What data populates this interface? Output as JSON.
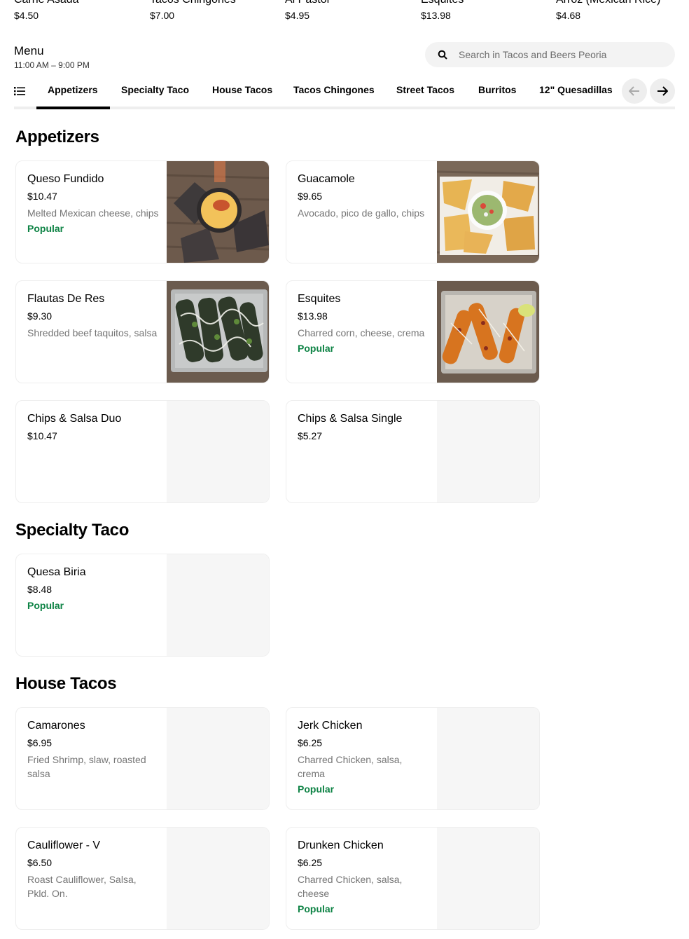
{
  "top_items": [
    {
      "name": "Carne Asada",
      "price": "$4.50"
    },
    {
      "name": "Tacos Chingones",
      "price": "$7.00"
    },
    {
      "name": "Al Pastor",
      "price": "$4.95"
    },
    {
      "name": "Esquites",
      "price": "$13.98"
    },
    {
      "name": "Arroz (Mexican Rice)",
      "price": "$4.68"
    }
  ],
  "menu": {
    "title": "Menu",
    "hours": "11:00 AM – 9:00 PM"
  },
  "search": {
    "placeholder": "Search in Tacos and Beers Peoria"
  },
  "tabs": [
    "Appetizers",
    "Specialty Taco",
    "House Tacos",
    "Tacos Chingones",
    "Street Tacos",
    "Burritos",
    "12\" Quesadillas"
  ],
  "active_tab": "Appetizers",
  "sections": [
    {
      "title": "Appetizers",
      "items": [
        {
          "name": "Queso Fundido",
          "price": "$10.47",
          "desc": "Melted Mexican cheese, chips",
          "popular": "Popular",
          "image": "queso-fundido-photo"
        },
        {
          "name": "Guacamole",
          "price": "$9.65",
          "desc": "Avocado, pico de gallo, chips",
          "popular": "",
          "image": "guacamole-photo"
        },
        {
          "name": "Flautas De Res",
          "price": "$9.30",
          "desc": "Shredded beef taquitos, salsa",
          "popular": "",
          "image": "flautas-photo"
        },
        {
          "name": "Esquites",
          "price": "$13.98",
          "desc": "Charred corn, cheese, crema",
          "popular": "Popular",
          "image": "esquites-photo"
        },
        {
          "name": "Chips & Salsa Duo",
          "price": "$10.47",
          "desc": "",
          "popular": ""
        },
        {
          "name": "Chips & Salsa Single",
          "price": "$5.27",
          "desc": "",
          "popular": ""
        }
      ]
    },
    {
      "title": "Specialty Taco",
      "items": [
        {
          "name": "Quesa Biria",
          "price": "$8.48",
          "desc": "",
          "popular": "Popular"
        }
      ]
    },
    {
      "title": "House Tacos",
      "items": [
        {
          "name": "Camarones",
          "price": "$6.95",
          "desc": "Fried Shrimp, slaw, roasted salsa",
          "popular": ""
        },
        {
          "name": "Jerk Chicken",
          "price": "$6.25",
          "desc": "Charred Chicken, salsa, crema",
          "popular": "Popular"
        },
        {
          "name": "Cauliflower - V",
          "price": "$6.50",
          "desc": "Roast Cauliflower, Salsa, Pkld. On.",
          "popular": ""
        },
        {
          "name": "Drunken Chicken",
          "price": "$6.25",
          "desc": "Charred Chicken, salsa, cheese",
          "popular": "Popular"
        }
      ]
    }
  ],
  "colors": {
    "popular": "#0e8345",
    "tab_active": "#000000",
    "search_bg": "#f3f3f3"
  },
  "icons": {
    "search": "search-icon",
    "list": "list-icon",
    "prev": "arrow-left-icon",
    "next": "arrow-right-icon"
  }
}
